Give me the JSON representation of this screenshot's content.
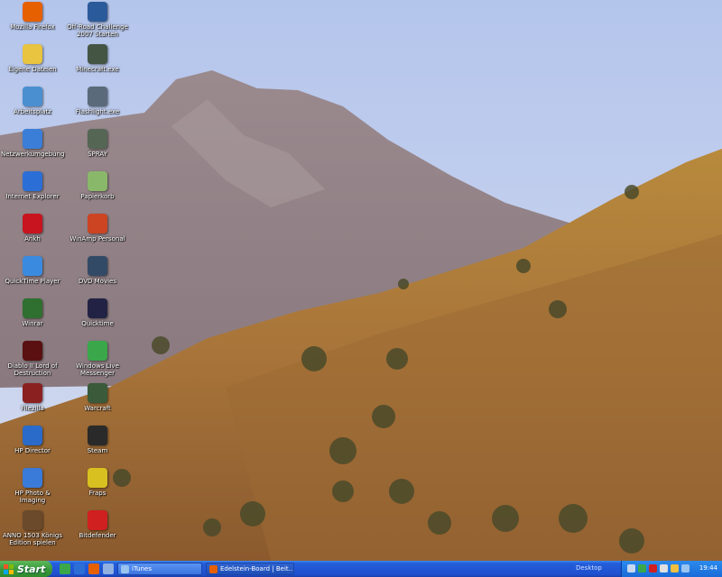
{
  "desktop_icons": [
    {
      "label": "Mozilla Firefox",
      "icon": "firefox-icon",
      "color": "#e66000"
    },
    {
      "label": "Off-Road Challenge 2007 Starten",
      "icon": "offroad-icon",
      "color": "#2a5a9a"
    },
    {
      "label": "Eigene Dateien",
      "icon": "folder-icon",
      "color": "#e8c440"
    },
    {
      "label": "Minecraft.exe",
      "icon": "minecraft-icon",
      "color": "#445544"
    },
    {
      "label": "Arbeitsplatz",
      "icon": "computer-icon",
      "color": "#4a8fd0"
    },
    {
      "label": "Flashlight.exe",
      "icon": "flashlight-icon",
      "color": "#5a6a7a"
    },
    {
      "label": "Netzwerkumgebung",
      "icon": "network-icon",
      "color": "#3b7ed8"
    },
    {
      "label": "SPRAY",
      "icon": "spray-icon",
      "color": "#556655"
    },
    {
      "label": "Internet Explorer",
      "icon": "ie-icon",
      "color": "#2b6fd6"
    },
    {
      "label": "Papierkorb",
      "icon": "recycle-bin-icon",
      "color": "#8ab86a"
    },
    {
      "label": "Ankh",
      "icon": "ankh-icon",
      "color": "#c8141e"
    },
    {
      "label": "WinAmp Personal",
      "icon": "winamp-icon",
      "color": "#cc4422"
    },
    {
      "label": "QuickTime Player",
      "icon": "quicktime-icon",
      "color": "#3a8be0"
    },
    {
      "label": "DVD Movies",
      "icon": "dvd-icon",
      "color": "#334a66"
    },
    {
      "label": "Winrar",
      "icon": "winrar-icon",
      "color": "#2f6f2f"
    },
    {
      "label": "Quicktime",
      "icon": "media-icon",
      "color": "#222244"
    },
    {
      "label": "Diablo II Lord of Destruction",
      "icon": "diablo-icon",
      "color": "#5a1010"
    },
    {
      "label": "Windows Live Messenger",
      "icon": "messenger-icon",
      "color": "#3aa84a"
    },
    {
      "label": "Filezilla",
      "icon": "filezilla-icon",
      "color": "#8a2020"
    },
    {
      "label": "Warcraft",
      "icon": "warcraft-icon",
      "color": "#3a5a3a"
    },
    {
      "label": "HP Director",
      "icon": "hp-director-icon",
      "color": "#2a6ac8"
    },
    {
      "label": "Steam",
      "icon": "steam-icon",
      "color": "#2a2a2a"
    },
    {
      "label": "HP Photo & Imaging",
      "icon": "hp-photo-icon",
      "color": "#3a7ad8"
    },
    {
      "label": "Fraps",
      "icon": "fraps-icon",
      "color": "#d8c020"
    },
    {
      "label": "ANNO 1503 Königs Edition spielen",
      "icon": "anno-icon",
      "color": "#6a4a2a"
    },
    {
      "label": "Bitdefender",
      "icon": "bitdefender-icon",
      "color": "#d02020"
    }
  ],
  "taskbar": {
    "start_label": "Start",
    "tasks": [
      {
        "label": "iTunes",
        "icon": "itunes-icon",
        "color": "#9ac4f0"
      },
      {
        "label": "Edelstein-Board | Beit...",
        "icon": "firefox-task-icon",
        "color": "#e66000"
      }
    ],
    "desktop_toolbar_label": "Desktop",
    "clock": "19:44"
  }
}
